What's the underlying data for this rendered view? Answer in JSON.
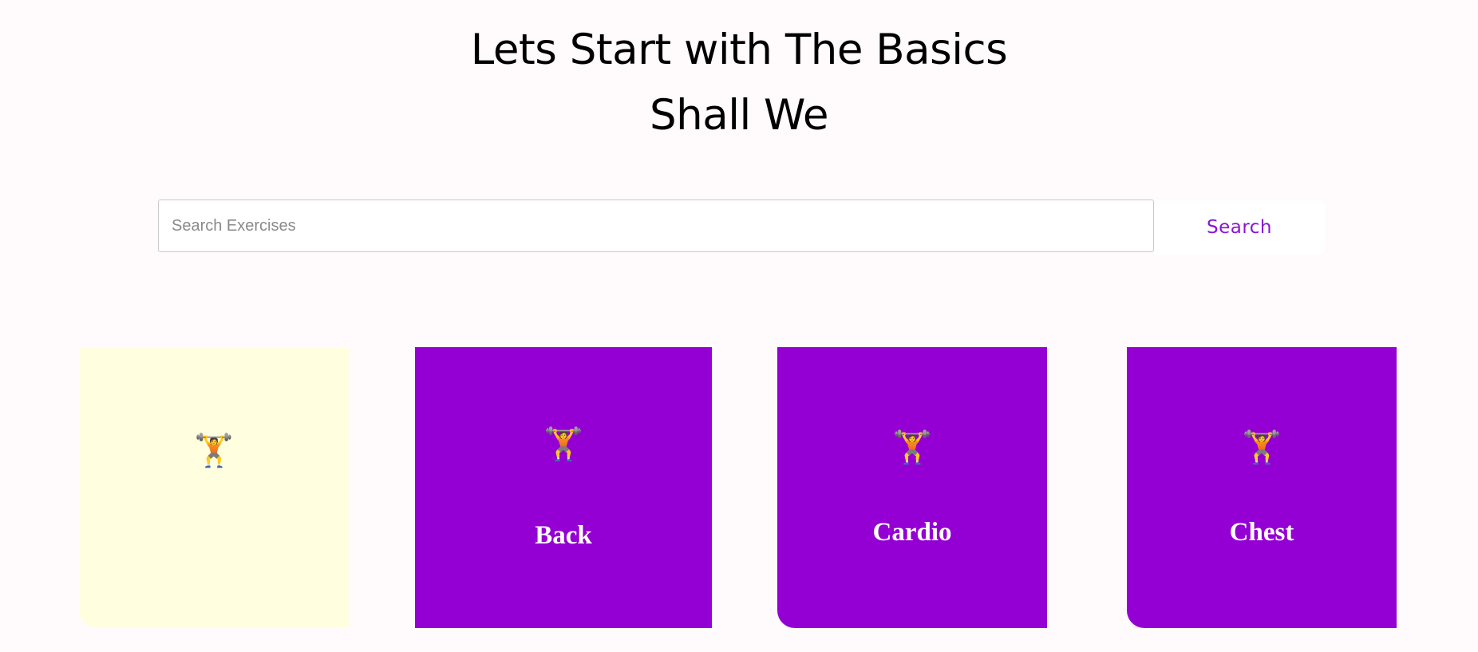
{
  "hero": {
    "line1": "Lets Start with The Basics",
    "line2": "Shall We"
  },
  "search": {
    "placeholder": "Search Exercises",
    "value": "",
    "button_label": "Search"
  },
  "colors": {
    "page_background": "#fffafb",
    "accent_purple": "#9400d3",
    "search_button_text": "#8a14d6",
    "first_card_background": "#ffffe0",
    "card_label_text": "#ffffff"
  },
  "categories": [
    {
      "label": "",
      "icon": "gym-building-icon",
      "icon_glyph": "🏋"
    },
    {
      "label": "Back",
      "icon": "gym-building-icon",
      "icon_glyph": "🏋"
    },
    {
      "label": "Cardio",
      "icon": "gym-building-icon",
      "icon_glyph": "🏋"
    },
    {
      "label": "Chest",
      "icon": "gym-building-icon",
      "icon_glyph": "🏋"
    }
  ]
}
